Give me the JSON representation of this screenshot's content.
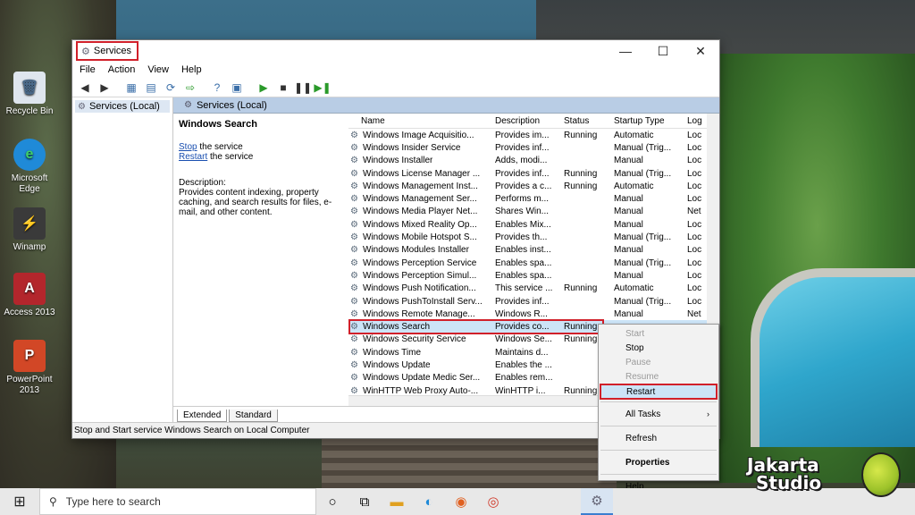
{
  "desktop": {
    "icons": [
      {
        "label": "Recycle Bin",
        "glyph": "🗑",
        "icon": "recycle-bin-icon"
      },
      {
        "label": "Microsoft Edge",
        "glyph": "e",
        "icon": "edge-icon"
      },
      {
        "label": "Winamp",
        "glyph": "⚡",
        "icon": "winamp-icon"
      },
      {
        "label": "Access 2013",
        "glyph": "A",
        "icon": "access-icon"
      },
      {
        "label": "PowerPoint 2013",
        "glyph": "P",
        "icon": "powerpoint-icon"
      }
    ]
  },
  "window": {
    "title": "Services",
    "controls": {
      "minimize": "—",
      "maximize": "☐",
      "close": "✕"
    },
    "menu": [
      "File",
      "Action",
      "View",
      "Help"
    ],
    "tree_item": "Services (Local)",
    "content_header": "Services (Local)",
    "detail": {
      "service_name": "Windows Search",
      "stop_link": "Stop",
      "stop_suffix": " the service",
      "restart_link": "Restart",
      "restart_suffix": " the service",
      "description_label": "Description:",
      "description": "Provides content indexing, property caching, and search results for files, e-mail, and other content."
    },
    "columns": {
      "name": "Name",
      "description": "Description",
      "status": "Status",
      "startup": "Startup Type",
      "log": "Log"
    },
    "services": [
      {
        "name": "Windows Image Acquisitio...",
        "desc": "Provides im...",
        "status": "Running",
        "startup": "Automatic",
        "log": "Loc"
      },
      {
        "name": "Windows Insider Service",
        "desc": "Provides inf...",
        "status": "",
        "startup": "Manual (Trig...",
        "log": "Loc"
      },
      {
        "name": "Windows Installer",
        "desc": "Adds, modi...",
        "status": "",
        "startup": "Manual",
        "log": "Loc"
      },
      {
        "name": "Windows License Manager ...",
        "desc": "Provides inf...",
        "status": "Running",
        "startup": "Manual (Trig...",
        "log": "Loc"
      },
      {
        "name": "Windows Management Inst...",
        "desc": "Provides a c...",
        "status": "Running",
        "startup": "Automatic",
        "log": "Loc"
      },
      {
        "name": "Windows Management Ser...",
        "desc": "Performs m...",
        "status": "",
        "startup": "Manual",
        "log": "Loc"
      },
      {
        "name": "Windows Media Player Net...",
        "desc": "Shares Win...",
        "status": "",
        "startup": "Manual",
        "log": "Net"
      },
      {
        "name": "Windows Mixed Reality Op...",
        "desc": "Enables Mix...",
        "status": "",
        "startup": "Manual",
        "log": "Loc"
      },
      {
        "name": "Windows Mobile Hotspot S...",
        "desc": "Provides th...",
        "status": "",
        "startup": "Manual (Trig...",
        "log": "Loc"
      },
      {
        "name": "Windows Modules Installer",
        "desc": "Enables inst...",
        "status": "",
        "startup": "Manual",
        "log": "Loc"
      },
      {
        "name": "Windows Perception Service",
        "desc": "Enables spa...",
        "status": "",
        "startup": "Manual (Trig...",
        "log": "Loc"
      },
      {
        "name": "Windows Perception Simul...",
        "desc": "Enables spa...",
        "status": "",
        "startup": "Manual",
        "log": "Loc"
      },
      {
        "name": "Windows Push Notification...",
        "desc": "This service ...",
        "status": "Running",
        "startup": "Automatic",
        "log": "Loc"
      },
      {
        "name": "Windows PushToInstall Serv...",
        "desc": "Provides inf...",
        "status": "",
        "startup": "Manual (Trig...",
        "log": "Loc"
      },
      {
        "name": "Windows Remote Manage...",
        "desc": "Windows R...",
        "status": "",
        "startup": "Manual",
        "log": "Net"
      },
      {
        "name": "Windows Search",
        "desc": "Provides co...",
        "status": "Running",
        "startup": "",
        "log": ""
      },
      {
        "name": "Windows Security Service",
        "desc": "Windows Se...",
        "status": "Running",
        "startup": "",
        "log": ""
      },
      {
        "name": "Windows Time",
        "desc": "Maintains d...",
        "status": "",
        "startup": "",
        "log": ""
      },
      {
        "name": "Windows Update",
        "desc": "Enables the ...",
        "status": "",
        "startup": "",
        "log": ""
      },
      {
        "name": "Windows Update Medic Ser...",
        "desc": "Enables rem...",
        "status": "",
        "startup": "",
        "log": ""
      },
      {
        "name": "WinHTTP Web Proxy Auto-...",
        "desc": "WinHTTP i...",
        "status": "Running",
        "startup": "",
        "log": ""
      }
    ],
    "selected_index": 15,
    "tabs": [
      "Extended",
      "Standard"
    ],
    "status_bar": "Stop and Start service Windows Search on Local Computer"
  },
  "context_menu": {
    "items": [
      {
        "label": "Start",
        "state": "disabled"
      },
      {
        "label": "Stop",
        "state": "normal"
      },
      {
        "label": "Pause",
        "state": "disabled"
      },
      {
        "label": "Resume",
        "state": "disabled"
      },
      {
        "label": "Restart",
        "state": "highlighted"
      },
      {
        "label": "All Tasks",
        "state": "submenu"
      },
      {
        "label": "Refresh",
        "state": "normal"
      },
      {
        "label": "Properties",
        "state": "bold"
      },
      {
        "label": "Help",
        "state": "normal"
      }
    ]
  },
  "taskbar": {
    "search_placeholder": "Type here to search",
    "apps": [
      "task-view-icon",
      "widgets-icon",
      "file-explorer-icon",
      "edge-icon",
      "firefox-icon",
      "chrome-icon",
      "services-icon"
    ]
  },
  "watermark": {
    "line1": "Jakarta",
    "line2": "Studio"
  },
  "colors": {
    "highlight_border": "#d1202a",
    "selection": "#cce4f7",
    "link": "#1a4fb0"
  }
}
